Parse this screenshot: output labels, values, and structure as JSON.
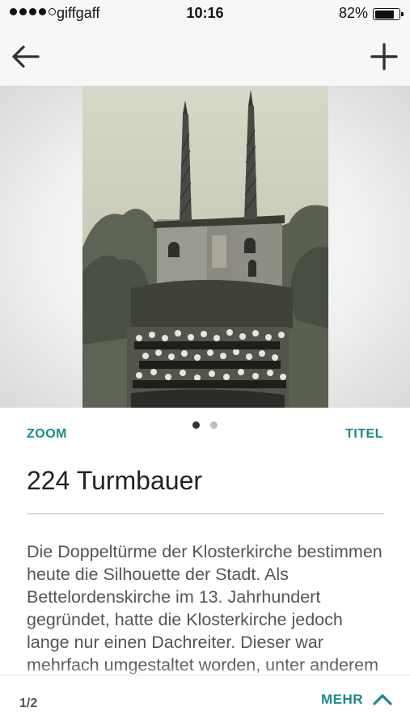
{
  "status_bar": {
    "carrier": "giffgaff",
    "time": "10:16",
    "battery": "82%",
    "battery_level": 0.82,
    "signal_bars": 4
  },
  "nav": {
    "back_icon": "arrow-left-icon",
    "add_icon": "plus-icon"
  },
  "controls": {
    "zoom_label": "ZOOM",
    "title_label": "TITEL",
    "pager_total": 2,
    "pager_active": 1
  },
  "item": {
    "title": "224 Turmbauer",
    "description": "Die Doppeltürme der Klosterkirche bestimmen heute die Silhouette der Stadt. Als Bettelordenskirche im 13. Jahrhundert gegründet, hatte die Klosterkirche jedoch lange nur einen Dachreiter. Dieser war mehrfach umgestaltet worden, unter anderem von"
  },
  "bottom_bar": {
    "page_indicator": "1/2",
    "more_label": "MEHR",
    "more_icon": "chevron-up-icon"
  },
  "colors": {
    "accent": "#1a8a8a",
    "text": "#222222",
    "body_text": "#555555"
  }
}
